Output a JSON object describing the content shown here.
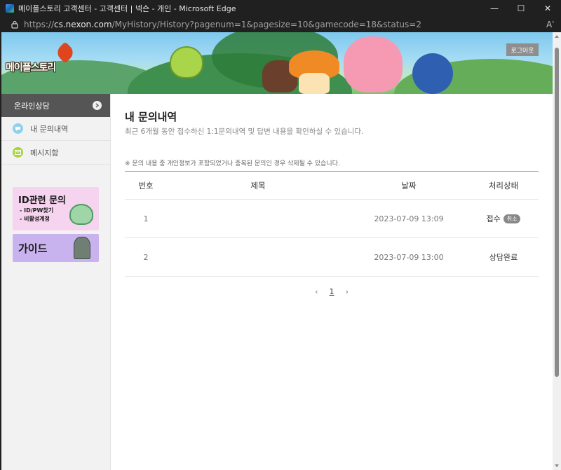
{
  "window": {
    "title": "메이플스토리 고객센터 - 고객센터 | 넥슨 - 개인 - Microsoft Edge",
    "minimize": "—",
    "maximize": "☐",
    "close": "✕"
  },
  "address": {
    "scheme": "https://",
    "host": "cs.nexon.com",
    "path": "/MyHistory/History?pagenum=1&pagesize=10&gamecode=18&status=2",
    "read_aloud": "Aʾ"
  },
  "banner": {
    "logo": "메이플스토리",
    "logout_label": "로그아웃"
  },
  "sidebar": {
    "header": "온라인상담",
    "items": [
      {
        "label": "내 문의내역",
        "icon": "chat-bubble-icon"
      },
      {
        "label": "메시지함",
        "icon": "mail-icon"
      }
    ],
    "promo_id": {
      "title": "ID관련 문의",
      "line1": "- ID/PW찾기",
      "line2": "- 비활성계정"
    },
    "promo_guide": {
      "title": "가이드"
    }
  },
  "main": {
    "title": "내 문의내역",
    "description": "최근 6개월 동안 접수하신 1:1문의내역 및 답변 내용을 확인하실 수 있습니다.",
    "notice": "※ 문의 내용 중 개인정보가 포함되었거나 중복된 문의인 경우 삭제될 수 있습니다.",
    "table": {
      "headers": {
        "num": "번호",
        "title": "제목",
        "date": "날짜",
        "status": "처리상태"
      },
      "rows": [
        {
          "num": "1",
          "title": "",
          "date": "2023-07-09 13:09",
          "status": "접수",
          "badge": "취소"
        },
        {
          "num": "2",
          "title": "",
          "date": "2023-07-09 13:00",
          "status": "상담완료"
        }
      ]
    },
    "pagination": {
      "prev": "‹",
      "page": "1",
      "next": "›"
    }
  }
}
